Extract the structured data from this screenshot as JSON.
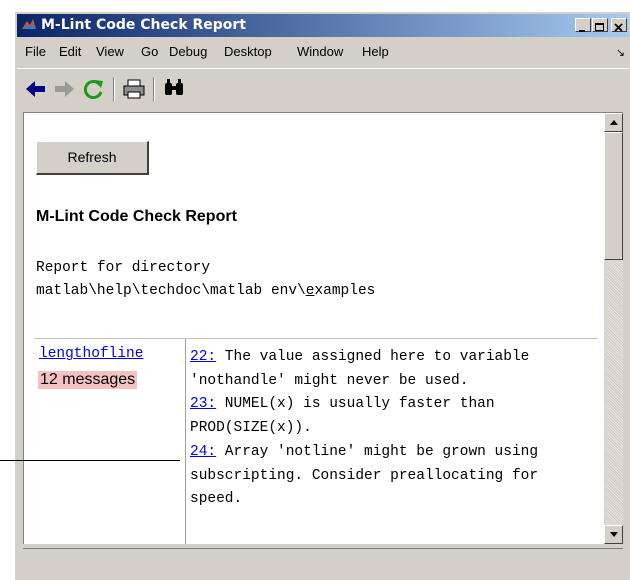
{
  "window": {
    "title": "M-Lint Code Check Report",
    "minimize_label": "_",
    "maximize_label": "□",
    "close_label": "×"
  },
  "menu": {
    "items": [
      "File",
      "Edit",
      "View",
      "Go",
      "Debug",
      "Desktop",
      "Window",
      "Help"
    ],
    "overflow": "↘"
  },
  "toolbar": {
    "icons": [
      "back-icon",
      "forward-icon",
      "refresh-icon",
      "print-icon",
      "find-icon"
    ]
  },
  "content": {
    "refresh_label": "Refresh",
    "heading": "M-Lint Code Check Report",
    "report_for": "Report for directory",
    "path_prefix": "matlab\\help\\techdoc\\matlab env\\",
    "path_underlined": "e",
    "path_suffix": "xamples",
    "file_link": "lengthofline",
    "message_count": "12 messages",
    "messages": [
      {
        "line": "22:",
        "text": " The value assigned here to variable 'nothandle' might never be used."
      },
      {
        "line": "23:",
        "text": " NUMEL(x) is usually faster than PROD(SIZE(x))."
      },
      {
        "line": "24:",
        "text": " Array 'notline' might be grown using subscripting. Consider preallocating for speed."
      }
    ]
  },
  "colors": {
    "title_gradient_start": "#0a246a",
    "title_gradient_end": "#a6caf0",
    "link": "#0000ee",
    "message_count_bg": "#f4c2c0",
    "chrome": "#d4d0c8"
  }
}
